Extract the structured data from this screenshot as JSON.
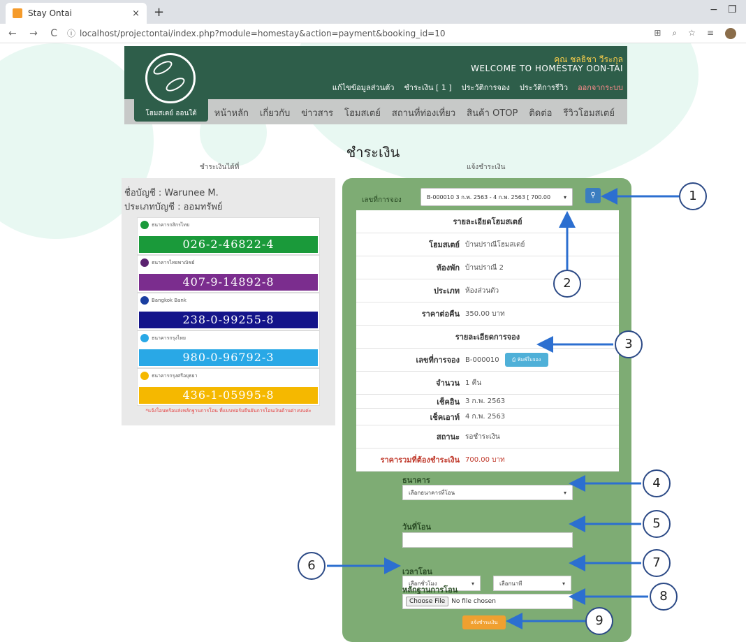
{
  "browser": {
    "tab_title": "Stay Ontai",
    "tab_close": "×",
    "new_tab": "+",
    "minimize": "−",
    "restore": "❐",
    "url": "localhost/projectontai/index.php?module=homestay&action=payment&booking_id=10"
  },
  "header": {
    "logo_text": "โฮมสเตย์ ออนใต้",
    "user_name": "คุณ ชลธิชา วีระกุล",
    "welcome": "WELCOME TO HOMESTAY OON-TAI",
    "user_menu": [
      "แก้ไขข้อมูลส่วนตัว",
      "ชำระเงิน [ 1 ]",
      "ประวัติการจอง",
      "ประวัติการรีวิว",
      "ออกจากระบบ"
    ],
    "main_menu": [
      "หน้าหลัก",
      "เกี่ยวกับ",
      "ข่าวสาร",
      "โฮมสเตย์",
      "สถานที่ท่องเที่ยว",
      "สินค้า OTOP",
      "ติดต่อ",
      "รีวิวโฮมสเตย์"
    ]
  },
  "page_title": "ชำระเงิน",
  "left": {
    "title": "ชำระเงินได้ที่",
    "account_name": "ชื่อบัญชี : Warunee M.",
    "account_type": "ประเภทบัญชี : ออมทรัพย์",
    "banks": [
      {
        "name": "ธนาคารกสิกรไทย",
        "number": "026-2-46822-4",
        "color": "#1a9a3a",
        "icon_color": "#1a9a3a"
      },
      {
        "name": "ธนาคารไทยพาณิชย์",
        "number": "407-9-14892-8",
        "color": "#7b2d8e",
        "icon_color": "#5b2270"
      },
      {
        "name": "Bangkok Bank",
        "number": "238-0-99255-8",
        "color": "#14148a",
        "icon_color": "#1a3ea0"
      },
      {
        "name": "ธนาคารกรุงไทย",
        "number": "980-0-96792-3",
        "color": "#29a8e6",
        "icon_color": "#29a8e6"
      },
      {
        "name": "ธนาคารกรุงศรีอยุธยา",
        "number": "436-1-05995-8",
        "color": "#f5b800",
        "icon_color": "#f5b800"
      }
    ],
    "note": "*แจ้งโอนพร้อมส่งหลักฐานการโอน ที่แบบฟอร์มยืนยันการโอนเงินด้านต่างบนค่ะ"
  },
  "right": {
    "title": "แจ้งชำระเงิน",
    "booking_label": "เลขที่การจอง",
    "booking_value": "B-000010 3 ก.พ. 2563 - 4 ก.พ. 2563 [ 700.00",
    "homestay_header": "รายละเอียดโฮมสเตย์",
    "homestay_rows": [
      {
        "key": "โฮมสเตย์",
        "value": "บ้านปราณีโฮมสเตย์"
      },
      {
        "key": "ห้องพัก",
        "value": "บ้านปราณี 2"
      },
      {
        "key": "ประเภท",
        "value": "ห้องส่วนตัว"
      },
      {
        "key": "ราคาต่อคืน",
        "value": "350.00 บาท"
      }
    ],
    "booking_header": "รายละเอียดการจอง",
    "booking_no_key": "เลขที่การจอง",
    "booking_no_value": "B-000010",
    "print_button": "พิมพ์ใบจอง",
    "booking_rows": [
      {
        "key": "จำนวน",
        "value": "1 คืน"
      },
      {
        "key": "เช็คอิน",
        "value": "3 ก.พ. 2563"
      },
      {
        "key": "เช็คเอาท์",
        "value": "4 ก.พ. 2563"
      },
      {
        "key": "สถานะ",
        "value": "รอชำระเงิน"
      }
    ],
    "total_key": "ราคารวมที่ต้องชำระเงิน",
    "total_value": "700.00 บาท",
    "bank_label": "ธนาคาร",
    "bank_select": "เลือกธนาคารที่โอน",
    "date_label": "วันที่โอน",
    "time_label": "เวลาโอน",
    "hour_select": "เลือกชั่วโมง",
    "minute_select": "เลือกนาที",
    "proof_label": "หลักฐานการโอน",
    "file_button": "Choose File",
    "file_status": "No file chosen",
    "submit_button": "แจ้งชำระเงิน"
  },
  "callouts": [
    "1",
    "2",
    "3",
    "4",
    "5",
    "6",
    "7",
    "8",
    "9"
  ]
}
